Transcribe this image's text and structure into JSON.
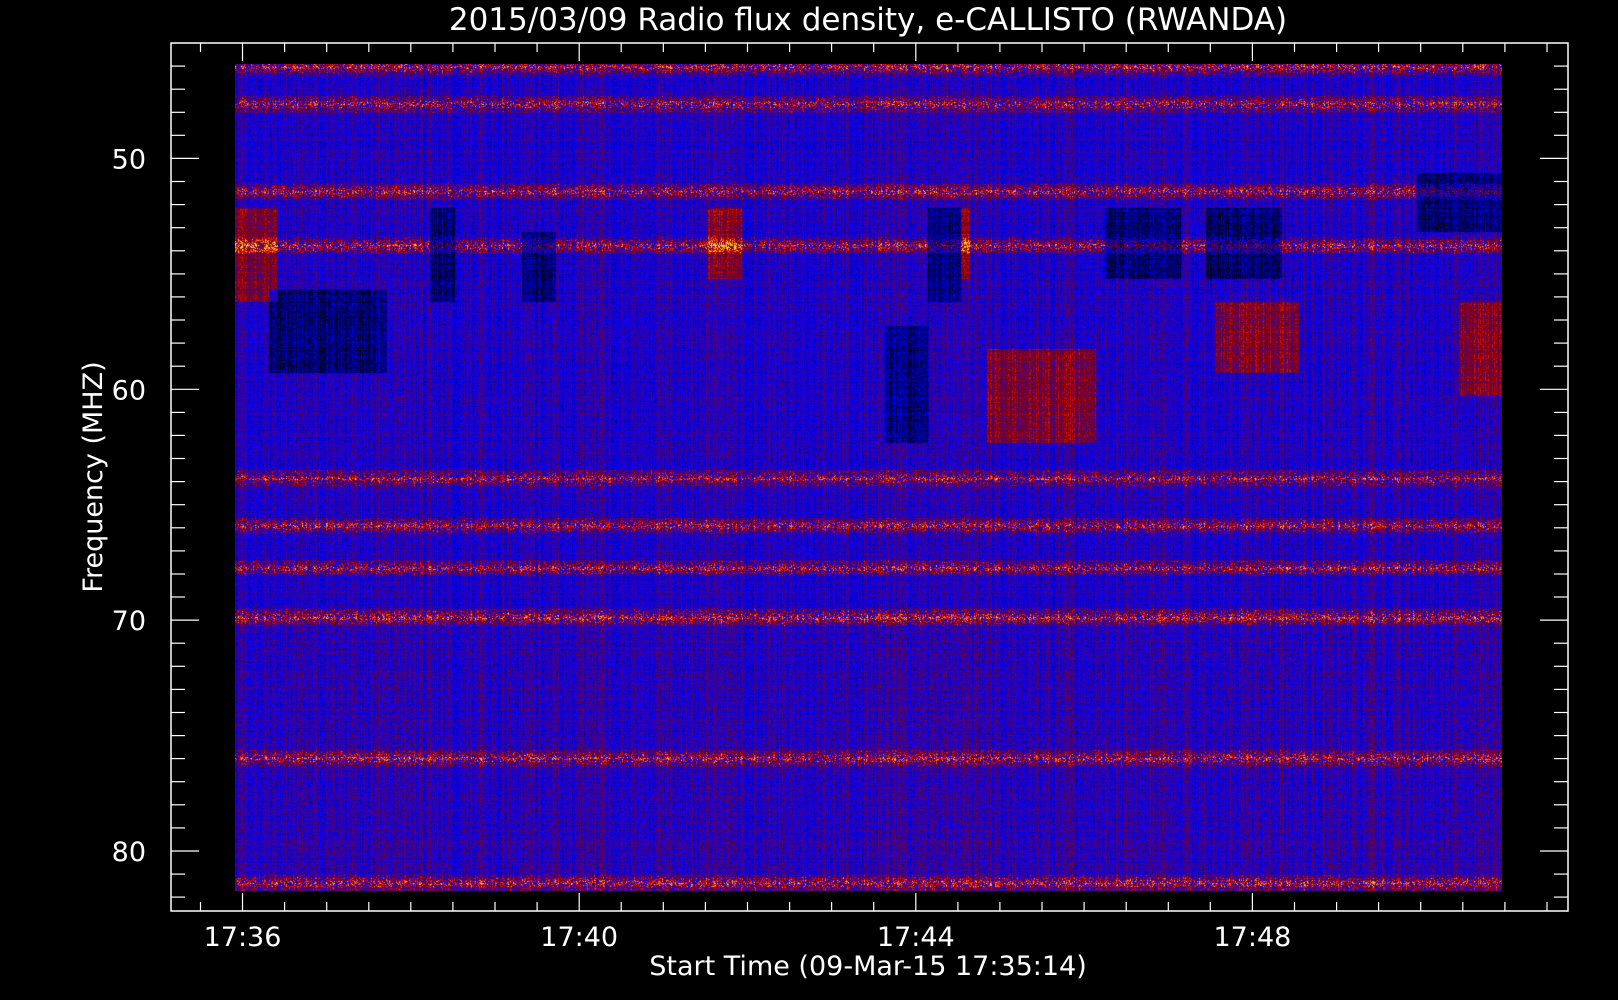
{
  "chart_data": {
    "type": "heatmap",
    "title": "2015/03/09  Radio flux density, e-CALLISTO (RWANDA)",
    "xlabel": "Start Time (09-Mar-15 17:35:14)",
    "ylabel": "Frequency (MHZ)",
    "x_ticks": [
      "17:36",
      "17:40",
      "17:44",
      "17:48"
    ],
    "x_tick_minutes": [
      36,
      40,
      44,
      48
    ],
    "y_ticks": [
      50,
      60,
      70,
      80
    ],
    "x_range_minutes": [
      35.15,
      51.75
    ],
    "data_x_range_minutes": [
      35.6,
      50.6
    ],
    "y_range": [
      45.0,
      82.6
    ],
    "data_y_range": [
      45.9,
      81.0
    ],
    "y_inverted": true,
    "colormap": [
      "#000000",
      "#0000ff",
      "#8b0000",
      "#ff2000",
      "#ffd040"
    ],
    "background": "#000000",
    "axis_color": "#ffffff",
    "features": {
      "hot_bands_mhz": [
        46.0,
        47.6,
        51.3,
        53.6,
        63.5,
        65.5,
        67.3,
        69.4,
        75.4,
        80.7
      ],
      "dark_patches": [
        {
          "t": [
            37.9,
            38.2
          ],
          "f": [
            52,
            56
          ]
        },
        {
          "t": [
            39.0,
            39.4
          ],
          "f": [
            53,
            56
          ]
        },
        {
          "t": [
            43.8,
            44.0
          ],
          "f": [
            52,
            56
          ]
        },
        {
          "t": [
            44.0,
            44.2
          ],
          "f": [
            52,
            56
          ]
        },
        {
          "t": [
            45.9,
            46.8
          ],
          "f": [
            52,
            55
          ]
        },
        {
          "t": [
            47.1,
            48.0
          ],
          "f": [
            52,
            55
          ]
        },
        {
          "t": [
            36.0,
            37.4
          ],
          "f": [
            55.5,
            59
          ]
        },
        {
          "t": [
            43.3,
            43.8
          ],
          "f": [
            57,
            62
          ]
        },
        {
          "t": [
            49.6,
            50.6
          ],
          "f": [
            50.5,
            53
          ]
        }
      ],
      "red_patches": [
        {
          "t": [
            35.6,
            36.1
          ],
          "f": [
            52,
            56
          ]
        },
        {
          "t": [
            41.2,
            41.6
          ],
          "f": [
            52,
            55
          ]
        },
        {
          "t": [
            44.2,
            44.3
          ],
          "f": [
            52,
            55
          ]
        },
        {
          "t": [
            44.5,
            45.8
          ],
          "f": [
            58,
            62
          ]
        },
        {
          "t": [
            47.2,
            48.2
          ],
          "f": [
            56,
            59
          ]
        },
        {
          "t": [
            50.1,
            50.6
          ],
          "f": [
            56,
            60
          ]
        }
      ]
    }
  }
}
